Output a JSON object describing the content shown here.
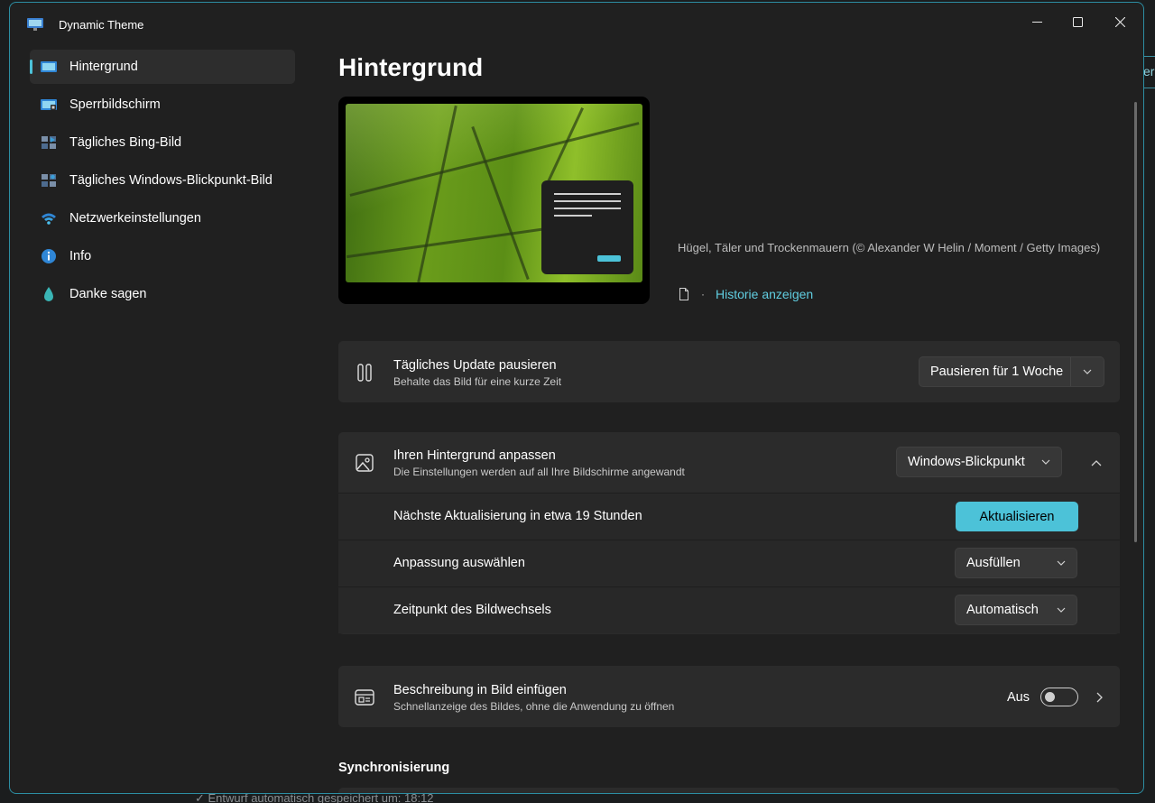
{
  "background": {
    "title_fragment": "",
    "status": "Entwurf automatisch gespeichert um: 18:12",
    "right_edge_text": "er"
  },
  "window": {
    "title": "Dynamic Theme",
    "controls": [
      "minimize",
      "maximize",
      "close"
    ]
  },
  "sidebar": {
    "items": [
      {
        "label": "Hintergrund",
        "icon": "monitor-icon",
        "active": true
      },
      {
        "label": "Sperrbildschirm",
        "icon": "lock-screen-icon",
        "active": false
      },
      {
        "label": "Tägliches Bing-Bild",
        "icon": "bing-image-icon",
        "active": false
      },
      {
        "label": "Tägliches Windows-Blickpunkt-Bild",
        "icon": "spotlight-image-icon",
        "active": false
      },
      {
        "label": "Netzwerkeinstellungen",
        "icon": "wifi-icon",
        "active": false
      },
      {
        "label": "Info",
        "icon": "info-icon",
        "active": false
      },
      {
        "label": "Danke sagen",
        "icon": "thanks-icon",
        "active": false
      }
    ]
  },
  "main": {
    "title": "Hintergrund",
    "caption": "Hügel, Täler und Trockenmauern (© Alexander W Helin / Moment / Getty Images)",
    "history_link": "Historie anzeigen",
    "pause": {
      "title": "Tägliches Update pausieren",
      "subtitle": "Behalte das Bild für eine kurze Zeit",
      "button": "Pausieren für 1 Woche"
    },
    "customize": {
      "title": "Ihren Hintergrund anpassen",
      "subtitle": "Die Einstellungen werden auf all Ihre Bildschirme angewandt",
      "source_value": "Windows-Blickpunkt",
      "next_update_label": "Nächste Aktualisierung in etwa 19 Stunden",
      "update_button": "Aktualisieren",
      "fit_label": "Anpassung auswählen",
      "fit_value": "Ausfüllen",
      "timing_label": "Zeitpunkt des Bildwechsels",
      "timing_value": "Automatisch"
    },
    "description": {
      "title": "Beschreibung in Bild einfügen",
      "subtitle": "Schnellanzeige des Bildes, ohne die Anwendung zu öffnen",
      "toggle_state": "Aus"
    },
    "sync_section_title": "Synchronisierung"
  },
  "colors": {
    "accent": "#4cc2d8",
    "window_bg": "#202020",
    "card_bg": "#2b2b2b"
  }
}
